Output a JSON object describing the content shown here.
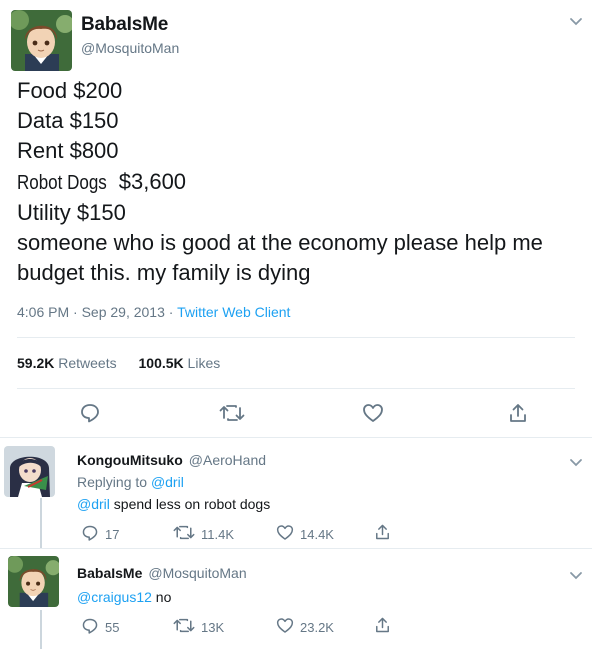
{
  "main_tweet": {
    "display_name": "BabaIsMe",
    "handle": "@MosquitoMan",
    "lines": [
      "Food $200",
      "Data $150",
      "Rent $800",
      "Robot Dogs",
      "$3,600",
      "Utility $150",
      "someone who is good at the economy please help me",
      "budget this. my family is dying"
    ],
    "timestamp": "4:06 PM · Sep 29, 2013 · ",
    "client": "Twitter Web Client",
    "retweets_count": "59.2K",
    "retweets_label": "Retweets",
    "likes_count": "100.5K",
    "likes_label": "Likes"
  },
  "replies": [
    {
      "display_name": "KongouMitsuko",
      "handle": "@AeroHand",
      "replying_prefix": "Replying to ",
      "replying_to": "@dril",
      "mention": "@dril",
      "text": " spend less on robot dogs",
      "reply_count": "17",
      "retweet_count": "11.4K",
      "like_count": "14.4K"
    },
    {
      "display_name": "BabaIsMe",
      "handle": "@MosquitoMan",
      "mention": "@craigus12",
      "text": " no",
      "reply_count": "55",
      "retweet_count": "13K",
      "like_count": "23.2K"
    }
  ],
  "colors": {
    "link": "#1da1f2",
    "muted": "#657786",
    "divider": "#e6ecf0"
  },
  "icons": [
    "chevron-down-icon",
    "reply-icon",
    "retweet-icon",
    "like-icon",
    "share-icon"
  ]
}
